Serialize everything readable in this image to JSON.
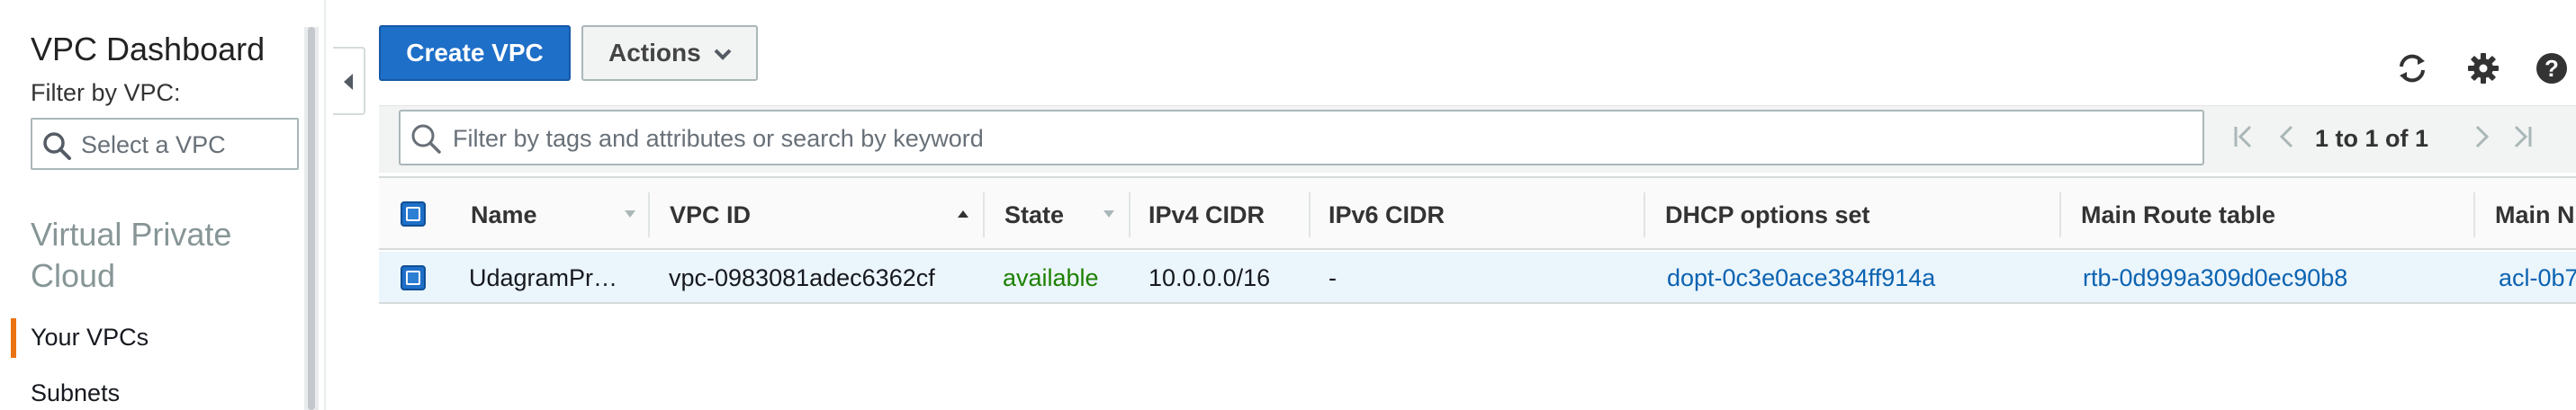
{
  "sidebar": {
    "title": "VPC Dashboard",
    "filter_label": "Filter by VPC:",
    "filter_placeholder": "Select a VPC",
    "section_title": "Virtual Private Cloud",
    "items": [
      {
        "label": "Your VPCs",
        "active": true
      },
      {
        "label": "Subnets",
        "active": false
      }
    ]
  },
  "toolbar": {
    "create_label": "Create VPC",
    "actions_label": "Actions",
    "icons": [
      "refresh-icon",
      "gear-icon",
      "help-icon"
    ]
  },
  "filter": {
    "placeholder": "Filter by tags and attributes or search by keyword",
    "pagination": "1 to 1 of 1"
  },
  "table": {
    "columns": [
      "Name",
      "VPC ID",
      "State",
      "IPv4 CIDR",
      "IPv6 CIDR",
      "DHCP options set",
      "Main Route table",
      "Main N"
    ],
    "rows": [
      {
        "name": "UdagramPr…",
        "vpc_id": "vpc-0983081adec6362cf",
        "state": "available",
        "ipv4": "10.0.0.0/16",
        "ipv6": "-",
        "dhcp": "dopt-0c3e0ace384ff914a",
        "route_table": "rtb-0d999a309d0ec90b8",
        "acl": "acl-0b7"
      }
    ]
  },
  "colors": {
    "primary": "#1e6fc8",
    "link": "#0b63b1",
    "available": "#1d8102",
    "active_marker": "#ec7211",
    "row_selected": "#ebf5fc"
  }
}
